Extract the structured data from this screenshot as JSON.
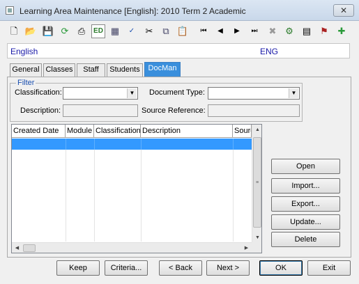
{
  "window": {
    "title": "Learning Area Maintenance  [English]:  2010 Term 2 Academic",
    "close_label": "✕"
  },
  "toolbar": {
    "icons": [
      "new-icon",
      "open-folder-icon",
      "save-icon",
      "refresh-icon",
      "print-icon",
      "edit-icon",
      "calculator-icon",
      "spellcheck-icon",
      "cut-icon",
      "copy-icon",
      "paste-icon",
      "first-record-icon",
      "previous-record-icon",
      "next-record-icon",
      "last-record-icon",
      "delete-icon",
      "settings-icon",
      "grid-icon",
      "users-icon",
      "add-record-icon"
    ],
    "edit_label": "ED"
  },
  "record": {
    "name": "English",
    "code": "ENG"
  },
  "tabs": [
    {
      "label": "General",
      "active": false
    },
    {
      "label": "Classes",
      "active": false
    },
    {
      "label": "Staff",
      "active": false
    },
    {
      "label": "Students",
      "active": false
    },
    {
      "label": "DocMan",
      "active": true
    }
  ],
  "filter": {
    "legend": "Filter",
    "classification_label": "Classification:",
    "classification_value": "",
    "document_type_label": "Document Type:",
    "document_type_value": "",
    "description_label": "Description:",
    "description_value": "",
    "source_reference_label": "Source Reference:",
    "source_reference_value": ""
  },
  "grid": {
    "columns": [
      "Created Date",
      "Module",
      "Classification",
      "Description",
      "Source"
    ],
    "rows": [
      [
        "",
        "",
        "",
        "",
        ""
      ]
    ]
  },
  "side_buttons": {
    "open": "Open",
    "import": "Import...",
    "export": "Export...",
    "update": "Update...",
    "delete": "Delete"
  },
  "bottom_buttons": {
    "keep": "Keep",
    "criteria": "Criteria...",
    "back": "< Back",
    "next": "Next >",
    "ok": "OK",
    "exit": "Exit"
  },
  "colors": {
    "accent": "#3399ff",
    "tab_active": "#3a8fdc",
    "record_text": "#1a1aa8",
    "legend": "#1a4fb0"
  }
}
